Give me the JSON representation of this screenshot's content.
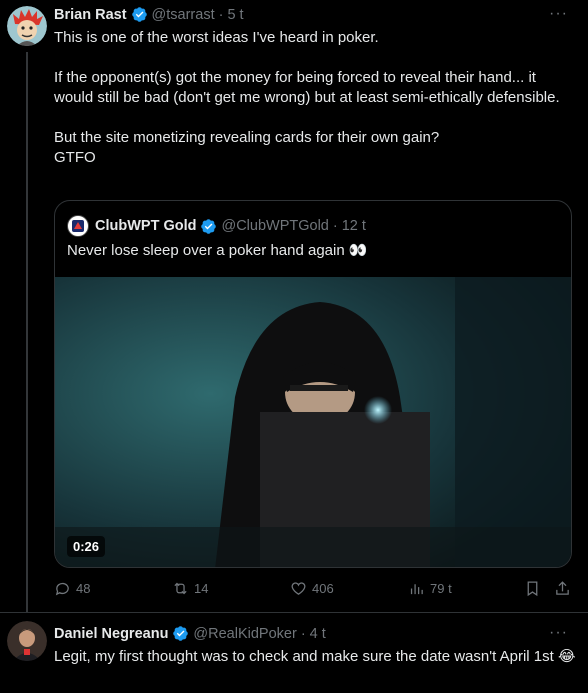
{
  "tweet1": {
    "name": "Brian Rast",
    "handle": "@tsarrast",
    "time": "5 t",
    "lines": [
      "This is one of the worst ideas I've heard in poker.",
      "",
      "If the opponent(s) got the money for being forced to reveal their hand... it would still be bad (don't get me wrong) but at least semi-ethically defensible.",
      "",
      "But the site monetizing revealing cards for their own gain?",
      "GTFO"
    ],
    "quote": {
      "name": "ClubWPT Gold",
      "handle": "@ClubWPTGold",
      "time": "12 t",
      "text": "Never lose sleep over a poker hand again 👀",
      "video_duration": "0:26"
    },
    "actions": {
      "replies": "48",
      "reposts": "14",
      "likes": "406",
      "views": "79 t"
    }
  },
  "tweet2": {
    "name": "Daniel Negreanu",
    "handle": "@RealKidPoker",
    "time": "4 t",
    "text": "Legit, my first thought was to check and make sure the date wasn't April 1st 😂"
  },
  "ui": {
    "dot": "·",
    "more": "···"
  },
  "colors": {
    "verified": "#1d9bf0",
    "muted": "#71767b",
    "text": "#e7e9ea",
    "border": "#2f3336"
  }
}
